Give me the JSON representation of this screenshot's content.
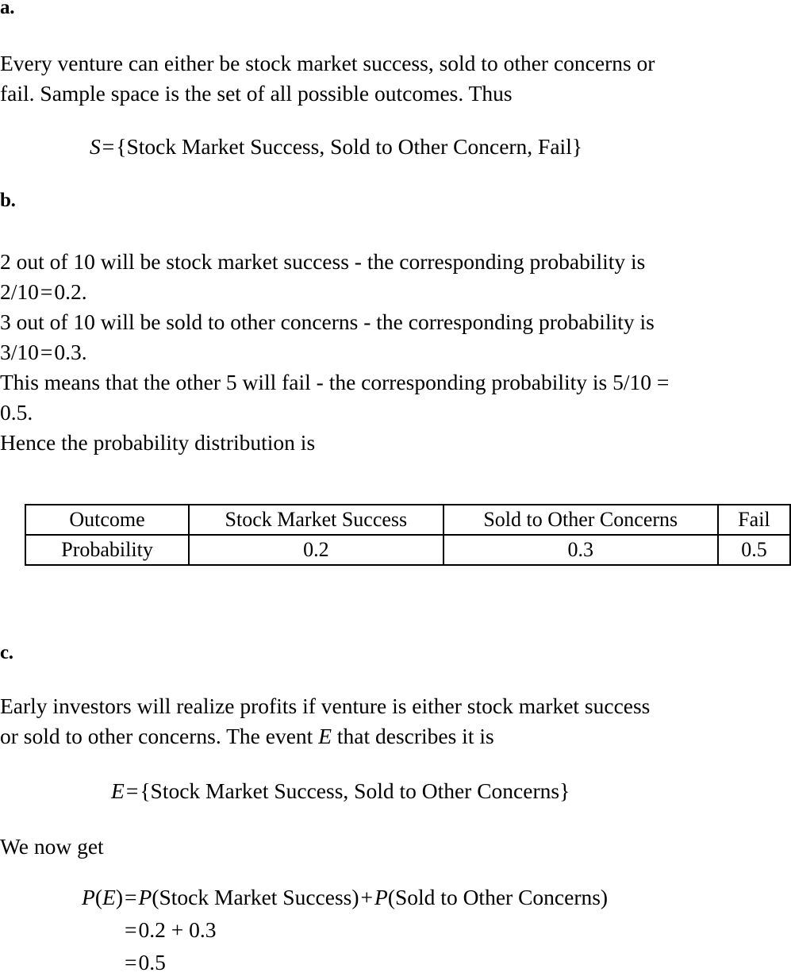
{
  "document": {
    "parts": [
      {
        "label": "a.",
        "paragraph_lines": [
          "Every venture can either be stock market success, sold to other concerns or",
          "fail. Sample space is the set of all possible outcomes. Thus"
        ],
        "equation": {
          "lhs_symbol": "S",
          "relation": "=",
          "set": "{Stock Market Success, Sold to Other Concern, Fail}"
        }
      },
      {
        "label": "b.",
        "lines": [
          "2 out of 10 will be stock market success - the corresponding probability is",
          "2/10 = 0.2.",
          "3 out of 10 will be sold to other concerns - the corresponding probability is",
          "3/10 = 0.3.",
          "This means that the other 5 will fail - the corresponding probability is 5/10 =",
          "0.5.",
          "Hence the probability distribution is"
        ],
        "table": {
          "row_headers": [
            "Outcome",
            "Probability"
          ],
          "columns": [
            "Stock Market Success",
            "Sold to Other Concerns",
            "Fail"
          ],
          "probabilities": [
            "0.2",
            "0.3",
            "0.5"
          ]
        }
      },
      {
        "label": "c.",
        "paragraph_lines": [
          "Early investors will realize profits if venture is either stock market success",
          "or sold to other concerns. The event E that describes it is"
        ],
        "event_symbol": "E",
        "equation": {
          "lhs_symbol": "E",
          "relation": "=",
          "set": "{Stock Market Success, Sold to Other Concerns}"
        },
        "lead_in": "We now get",
        "aligned_equation": {
          "row1_lhs": "P(E)",
          "row1_rel": "=",
          "row1_rhs_a": "P(Stock Market Success)",
          "row1_plus": "+",
          "row1_rhs_b": "P(Sold to Other Concerns)",
          "row2_rel": "=",
          "row2_rhs": "0.2 + 0.3",
          "row3_rel": "=",
          "row3_rhs": "0.5"
        }
      }
    ]
  },
  "text": {
    "part_a_label": "a.",
    "part_b_label": "b.",
    "part_c_label": "c.",
    "a_line1_a": "Every venture can either be stock market success, sold to other concerns or",
    "a_line2": "fail. Sample space is the set of all possible outcomes.  Thus",
    "a_eq_lhs": "S",
    "a_eq_rel": "=",
    "a_eq_set": "{Stock Market Success, Sold to Other Concern, Fail}",
    "b_line1": "2 out of 10 will be stock market success - the corresponding probability is",
    "b_line2_frac": "2/10",
    "b_line2_rel": "=",
    "b_line2_val": "0.2.",
    "b_line3": "3 out of 10 will be sold to other concerns - the corresponding probability is",
    "b_line4_frac": "3/10",
    "b_line4_rel": "=",
    "b_line4_val": "0.3.",
    "b_line5": "This means that the other 5 will fail - the corresponding probability is 5/10 =",
    "b_line6": "0.5.",
    "b_line7": "Hence the probability distribution is",
    "t_outcome": "Outcome",
    "t_probability": "Probability",
    "t_col1": "Stock Market Success",
    "t_col2": "Sold to Other Concerns",
    "t_col3": "Fail",
    "t_p1": "0.2",
    "t_p2": "0.3",
    "t_p3": "0.5",
    "c_line1": "Early investors will realize profits if venture is either stock market success",
    "c_line2_pre": "or sold to other concerns.  The event ",
    "c_line2_sym": "E",
    "c_line2_post": " that describes it is",
    "c_eq_lhs": "E",
    "c_eq_rel": "=",
    "c_eq_set": "{Stock Market Success, Sold to Other Concerns}",
    "c_lead_in": "We now get",
    "eq_r1_lhs_p": "P",
    "eq_r1_lhs_open": "(",
    "eq_r1_lhs_e": "E",
    "eq_r1_lhs_close": ")",
    "eq_r1_rel": "=",
    "eq_r1_pa": "P",
    "eq_r1_arg_a": "(Stock Market Success)",
    "eq_r1_plus": "+",
    "eq_r1_pb": "P",
    "eq_r1_arg_b": "(Sold to Other Concerns)",
    "eq_r2_rel": "=",
    "eq_r2_rhs": "0.2 + 0.3",
    "eq_r3_rel": "=",
    "eq_r3_rhs": "0.5"
  }
}
